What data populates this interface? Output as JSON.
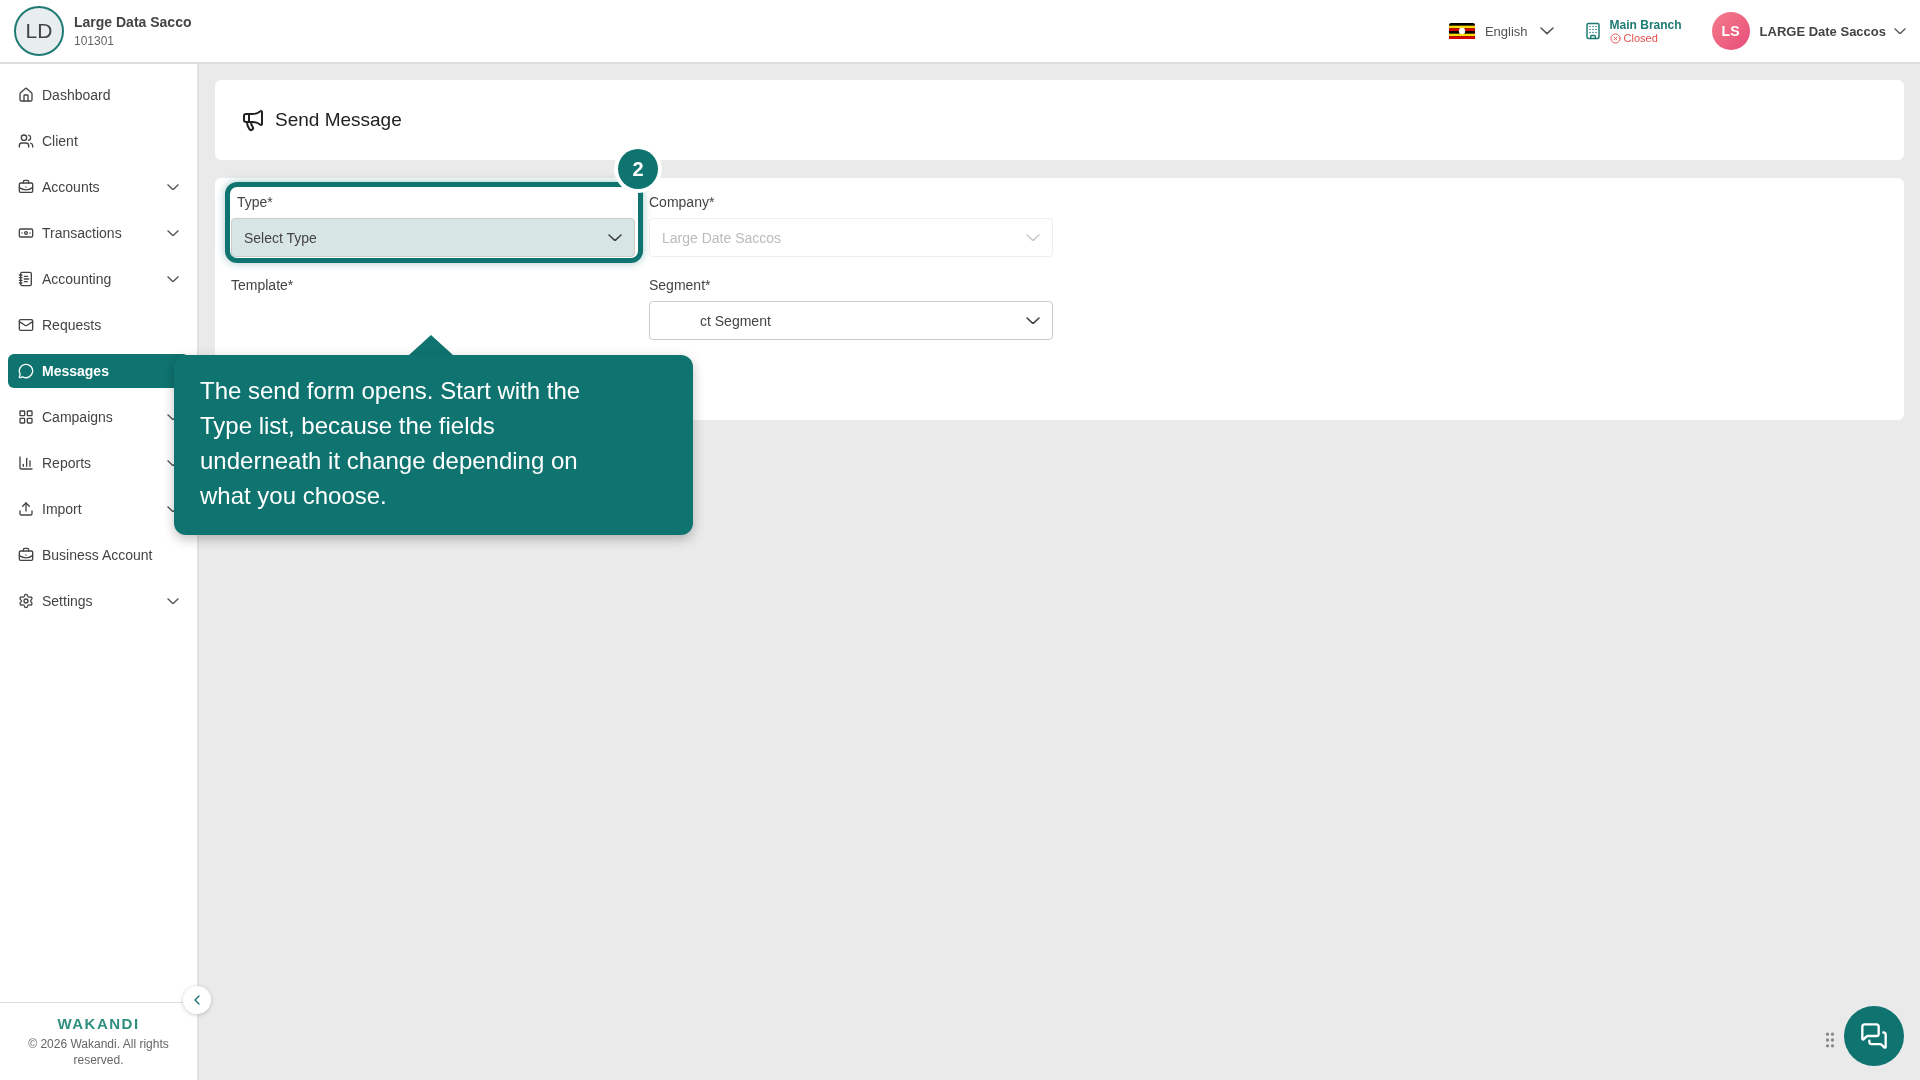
{
  "org": {
    "initials": "LD",
    "name": "Large Data Sacco",
    "code": "101301"
  },
  "header": {
    "language": "English",
    "branch": {
      "name": "Main Branch",
      "status": "Closed"
    },
    "user": {
      "initials": "LS",
      "name": "LARGE Date Saccos"
    }
  },
  "sidebar": {
    "items": [
      {
        "label": "Dashboard",
        "expandable": false,
        "selected": false
      },
      {
        "label": "Client",
        "expandable": false,
        "selected": false
      },
      {
        "label": "Accounts",
        "expandable": true,
        "selected": false
      },
      {
        "label": "Transactions",
        "expandable": true,
        "selected": false
      },
      {
        "label": "Accounting",
        "expandable": true,
        "selected": false
      },
      {
        "label": "Requests",
        "expandable": false,
        "selected": false
      },
      {
        "label": "Messages",
        "expandable": false,
        "selected": true
      },
      {
        "label": "Campaigns",
        "expandable": true,
        "selected": false
      },
      {
        "label": "Reports",
        "expandable": true,
        "selected": false
      },
      {
        "label": "Import",
        "expandable": true,
        "selected": false
      },
      {
        "label": "Business Account",
        "expandable": false,
        "selected": false
      },
      {
        "label": "Settings",
        "expandable": true,
        "selected": false
      }
    ],
    "footer": {
      "logo": "WAKANDI",
      "copyright": "© 2026 Wakandi. All rights reserved."
    }
  },
  "page_title": "Send Message",
  "form": {
    "fields": [
      {
        "label": "Type*",
        "value": "Select Type",
        "disabled": false,
        "highlighted": true
      },
      {
        "label": "Company*",
        "placeholder": "Large Date Saccos",
        "disabled": true,
        "highlighted": false
      },
      {
        "label": "Template*"
      },
      {
        "label": "Segment*",
        "value": "ct Segment",
        "disabled": false,
        "highlighted": false
      }
    ]
  },
  "tour": {
    "step": "2",
    "text": "The send form opens. Start with the Type list, because the fields underneath it change depending on what you choose."
  }
}
